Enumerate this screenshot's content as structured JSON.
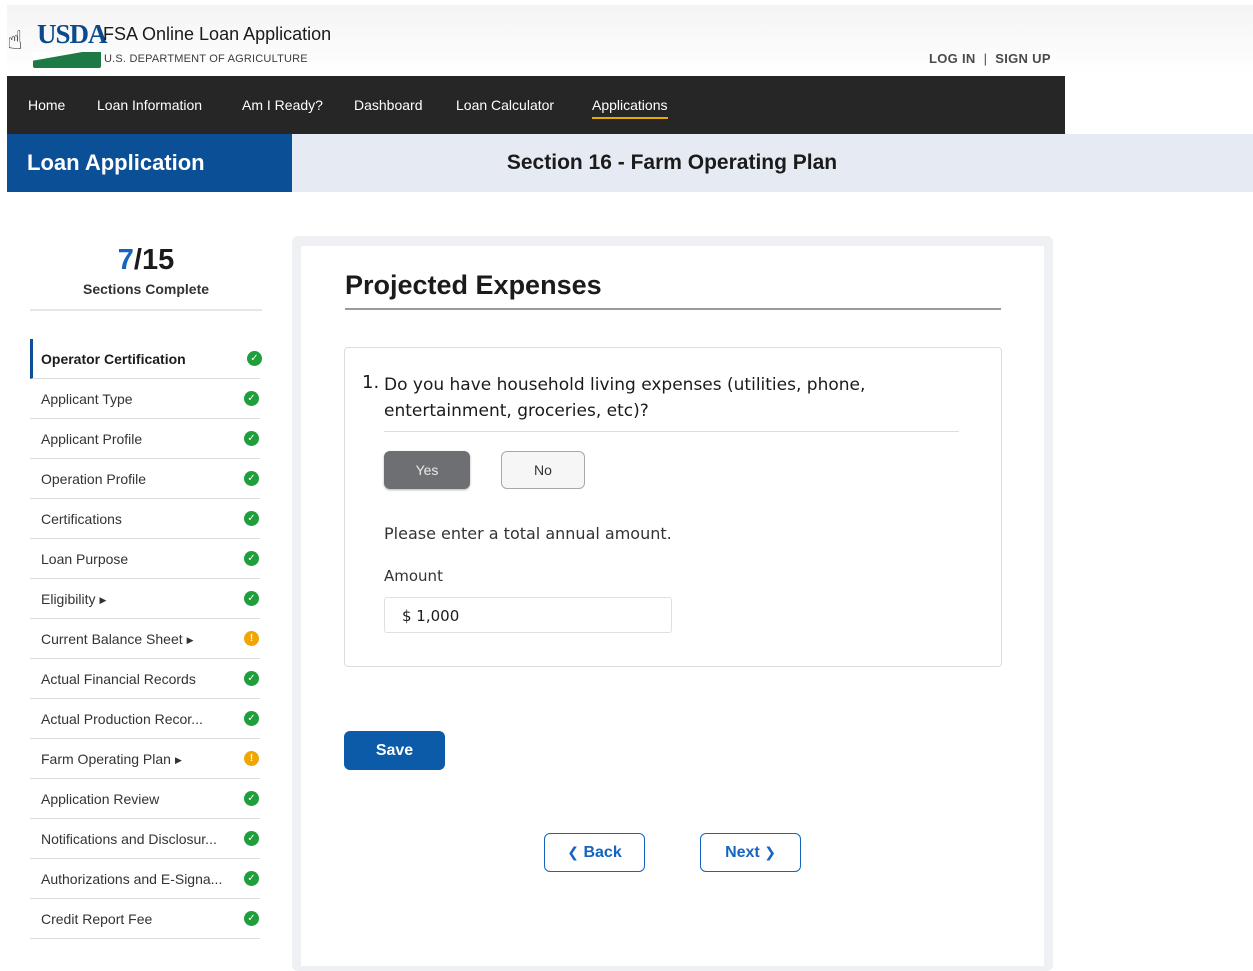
{
  "header": {
    "logo_text": "USDA",
    "app_title": "FSA Online Loan Application",
    "app_subtitle": "U.S. DEPARTMENT OF AGRICULTURE",
    "login": "LOG IN",
    "separator": "|",
    "signup": "SIGN UP"
  },
  "nav": {
    "items": [
      "Home",
      "Loan Information",
      "Am I Ready?",
      "Dashboard",
      "Loan Calculator",
      "Applications"
    ],
    "active": "Applications",
    "active_color": "#e8a900"
  },
  "section_bar": {
    "left_title": "Loan Application",
    "right_title": "Section 16 - Farm Operating Plan",
    "left_color": "#0b4f96"
  },
  "progress": {
    "done": "7",
    "total": "/15",
    "label": "Sections Complete"
  },
  "sidebar": {
    "items": [
      {
        "label": "Operator Certification",
        "status": "complete",
        "current": true,
        "expandable": false
      },
      {
        "label": "Applicant Type",
        "status": "complete",
        "expandable": false
      },
      {
        "label": "Applicant Profile",
        "status": "complete",
        "expandable": false
      },
      {
        "label": "Operation Profile",
        "status": "complete",
        "expandable": false
      },
      {
        "label": "Certifications",
        "status": "complete",
        "expandable": false
      },
      {
        "label": "Loan Purpose",
        "status": "complete",
        "expandable": false
      },
      {
        "label": "Eligibility",
        "status": "complete",
        "expandable": true
      },
      {
        "label": "Current Balance Sheet",
        "status": "warning",
        "expandable": true
      },
      {
        "label": "Actual Financial Records",
        "status": "complete",
        "expandable": false
      },
      {
        "label": "Actual Production Recor...",
        "status": "complete",
        "expandable": false
      },
      {
        "label": "Farm Operating Plan",
        "status": "warning",
        "expandable": true
      },
      {
        "label": "Application Review",
        "status": "complete",
        "expandable": false
      },
      {
        "label": "Notifications and Disclosur...",
        "status": "complete",
        "expandable": false
      },
      {
        "label": "Authorizations and E-Signa...",
        "status": "complete",
        "expandable": false
      },
      {
        "label": "Credit Report Fee",
        "status": "complete",
        "expandable": false
      }
    ],
    "status_colors": {
      "complete": "#1f9e3b",
      "warning": "#f0a500"
    },
    "status_icons": {
      "complete": "check-circle-icon",
      "warning": "alert-circle-icon"
    }
  },
  "main": {
    "heading": "Projected Expenses",
    "question": {
      "number": "1.",
      "text": "Do you have household living expenses (utilities, phone, entertainment, groceries, etc)?",
      "yes_label": "Yes",
      "no_label": "No",
      "selected": "Yes"
    },
    "prompt": "Please enter a total annual amount.",
    "amount_label": "Amount",
    "amount_value": "$ 1,000",
    "save_label": "Save",
    "back_label": "Back",
    "next_label": "Next"
  }
}
